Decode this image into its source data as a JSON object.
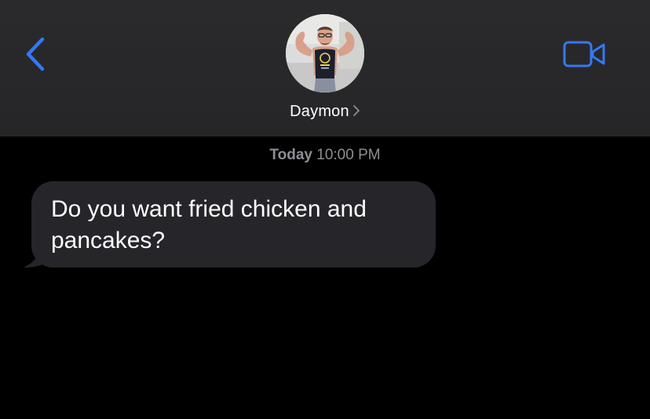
{
  "header": {
    "contact_name": "Daymon",
    "back_icon": "chevron-left-icon",
    "video_icon": "video-camera-icon",
    "disclosure_icon": "chevron-right-icon"
  },
  "conversation": {
    "timestamp_day": "Today",
    "timestamp_time": "10:00 PM",
    "messages": [
      {
        "direction": "incoming",
        "text_line_1": "Do you want fried chicken and",
        "text_line_2": "pancakes?"
      }
    ]
  },
  "colors": {
    "accent": "#3478f6",
    "header_bg": "#2a2a2c",
    "bubble_bg": "#26252a",
    "timestamp": "#8e8e93",
    "background": "#000000"
  }
}
